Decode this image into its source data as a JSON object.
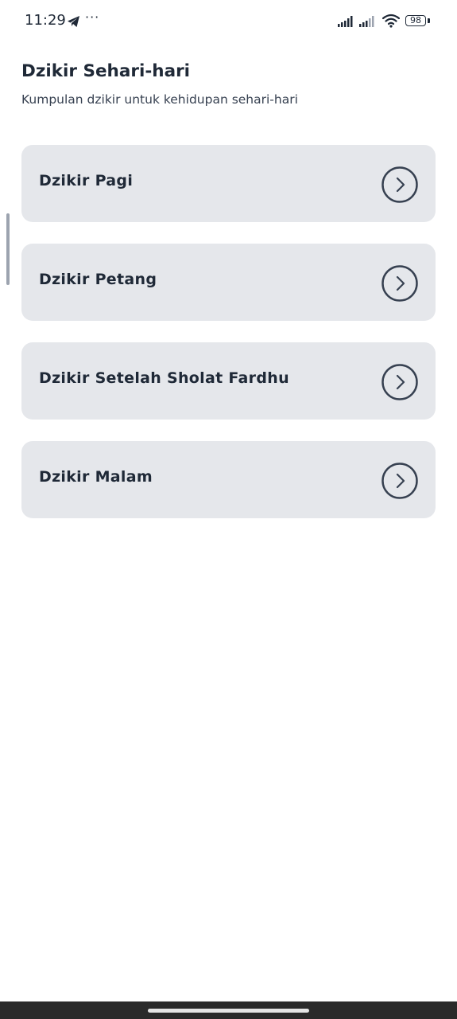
{
  "status_bar": {
    "time": "11:29",
    "dots": "···",
    "battery_level": "98",
    "icons": [
      "telegram-icon",
      "signal-icon",
      "signal-icon",
      "wifi-icon",
      "battery-icon"
    ]
  },
  "header": {
    "title": "Dzikir Sehari-hari",
    "subtitle": "Kumpulan dzikir untuk kehidupan sehari-hari"
  },
  "menu": {
    "items": [
      {
        "label": "Dzikir Pagi",
        "icon": "chevron-right-circle-icon"
      },
      {
        "label": "Dzikir Petang",
        "icon": "chevron-right-circle-icon"
      },
      {
        "label": "Dzikir Setelah Sholat Fardhu",
        "icon": "chevron-right-circle-icon"
      },
      {
        "label": "Dzikir Malam",
        "icon": "chevron-right-circle-icon"
      }
    ]
  },
  "colors": {
    "background": "#ffffff",
    "card": "#e5e7eb",
    "text": "#1f2937",
    "nav_bar": "#2a2a2a"
  }
}
